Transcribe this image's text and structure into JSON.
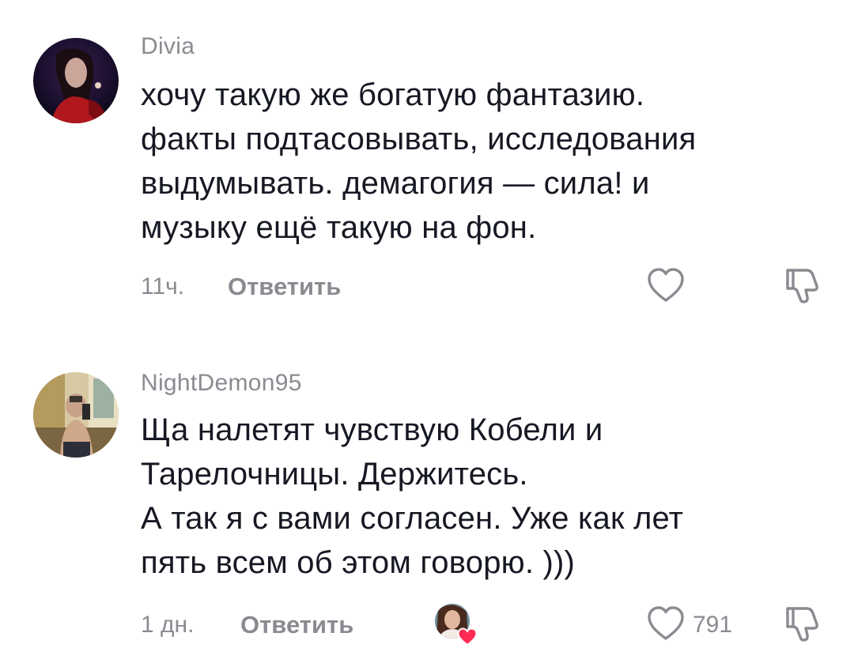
{
  "comments": [
    {
      "username": "Divia",
      "text": "хочу такую же богатую фантазию.\nфакты подтасовывать, исследования\nвыдумывать. демагогия — сила! и\nмузыку ещё такую на фон.",
      "time": "11ч.",
      "reply_label": "Ответить",
      "like_count": "",
      "icons": {
        "like": "heart-outline-icon",
        "dislike": "thumbs-down-icon"
      }
    },
    {
      "username": "NightDemon95",
      "text": "Ща налетят чувствую Кобели и\nТарелочницы. Держитесь.\nА так я с вами согласен. Уже как лет\nпять всем об этом говорю. )))",
      "time": "1 дн.",
      "reply_label": "Ответить",
      "like_count": "791",
      "icons": {
        "like": "heart-outline-icon",
        "dislike": "thumbs-down-icon",
        "creator_badge": "heart-badge-icon"
      }
    }
  ],
  "colors": {
    "text_primary": "#161823",
    "text_secondary": "#8a8b91",
    "heart_badge": "#fe2c55"
  }
}
